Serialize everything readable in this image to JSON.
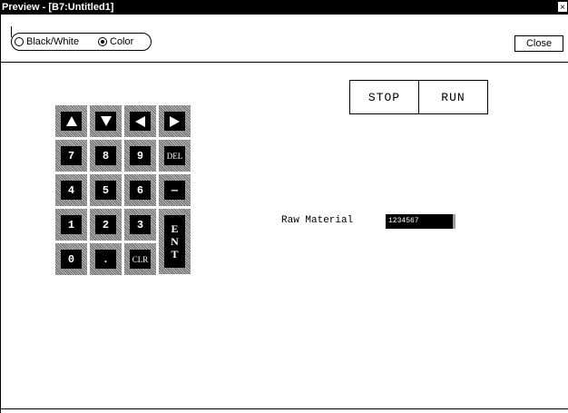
{
  "window": {
    "title": "Preview - [B7:Untitled1]",
    "close_glyph": "×"
  },
  "toolbar": {
    "radio_options": [
      {
        "label": "Black/White",
        "selected": false
      },
      {
        "label": "Color",
        "selected": true
      }
    ],
    "close_label": "Close"
  },
  "screen": {
    "stop_label": "STOP",
    "run_label": "RUN",
    "keypad": {
      "arrows": [
        "up-arrow",
        "down-arrow",
        "left-arrow",
        "right-arrow"
      ],
      "row2": [
        "7",
        "8",
        "9",
        "DEL"
      ],
      "row3": [
        "4",
        "5",
        "6",
        "—"
      ],
      "row4": [
        "1",
        "2",
        "3"
      ],
      "row5": [
        "0",
        ".",
        "CLR"
      ],
      "ent": [
        "E",
        "N",
        "T"
      ]
    },
    "raw_material_label": "Raw Material",
    "raw_material_value": "1234567"
  }
}
